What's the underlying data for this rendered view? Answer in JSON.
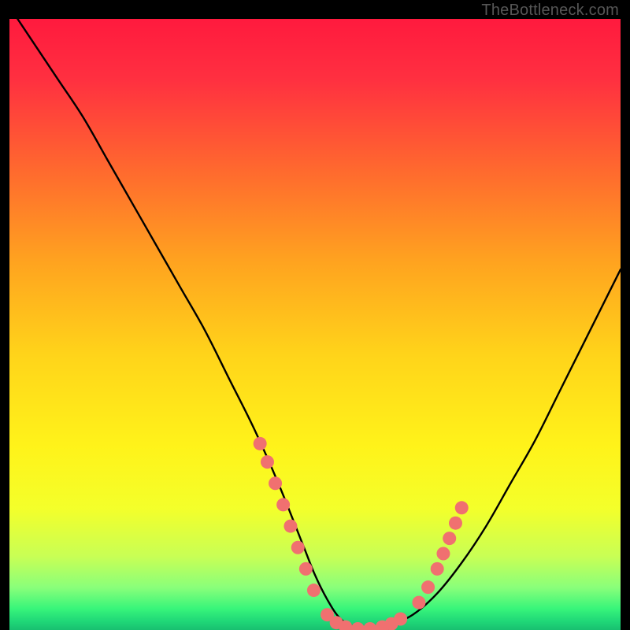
{
  "watermark": "TheBottleneck.com",
  "chart_data": {
    "type": "line",
    "title": "",
    "xlabel": "",
    "ylabel": "",
    "xlim": [
      0,
      100
    ],
    "ylim": [
      0,
      100
    ],
    "series": [
      {
        "name": "curve",
        "x": [
          0,
          4,
          8,
          12,
          16,
          20,
          24,
          28,
          32,
          36,
          40,
          44,
          48,
          50,
          52,
          54,
          56,
          58,
          60,
          62,
          66,
          70,
          74,
          78,
          82,
          86,
          90,
          94,
          98,
          100
        ],
        "y": [
          102,
          96,
          90,
          84,
          77,
          70,
          63,
          56,
          49,
          41,
          33,
          24,
          14,
          9,
          5,
          2,
          0.7,
          0.2,
          0.2,
          0.7,
          2.5,
          6,
          11,
          17,
          24,
          31,
          39,
          47,
          55,
          59
        ]
      }
    ],
    "markers": {
      "name": "dots",
      "color": "#f07070",
      "points": [
        {
          "x": 41.0,
          "y": 30.5
        },
        {
          "x": 42.2,
          "y": 27.5
        },
        {
          "x": 43.5,
          "y": 24.0
        },
        {
          "x": 44.8,
          "y": 20.5
        },
        {
          "x": 46.0,
          "y": 17.0
        },
        {
          "x": 47.2,
          "y": 13.5
        },
        {
          "x": 48.5,
          "y": 10.0
        },
        {
          "x": 49.8,
          "y": 6.5
        },
        {
          "x": 52.0,
          "y": 2.5
        },
        {
          "x": 53.5,
          "y": 1.2
        },
        {
          "x": 55.0,
          "y": 0.5
        },
        {
          "x": 57.0,
          "y": 0.2
        },
        {
          "x": 59.0,
          "y": 0.2
        },
        {
          "x": 61.0,
          "y": 0.5
        },
        {
          "x": 62.5,
          "y": 1.0
        },
        {
          "x": 64.0,
          "y": 1.8
        },
        {
          "x": 67.0,
          "y": 4.5
        },
        {
          "x": 68.5,
          "y": 7.0
        },
        {
          "x": 70.0,
          "y": 10.0
        },
        {
          "x": 71.0,
          "y": 12.5
        },
        {
          "x": 72.0,
          "y": 15.0
        },
        {
          "x": 73.0,
          "y": 17.5
        },
        {
          "x": 74.0,
          "y": 20.0
        }
      ]
    },
    "gradient_stops": [
      {
        "offset": 0.0,
        "color": "#ff1a3e"
      },
      {
        "offset": 0.1,
        "color": "#ff3040"
      },
      {
        "offset": 0.25,
        "color": "#ff6a2e"
      },
      {
        "offset": 0.4,
        "color": "#ffa41f"
      },
      {
        "offset": 0.55,
        "color": "#ffd41a"
      },
      {
        "offset": 0.7,
        "color": "#fff31a"
      },
      {
        "offset": 0.8,
        "color": "#f4ff2a"
      },
      {
        "offset": 0.88,
        "color": "#c8ff55"
      },
      {
        "offset": 0.93,
        "color": "#8aff7a"
      },
      {
        "offset": 0.965,
        "color": "#38f57a"
      },
      {
        "offset": 0.985,
        "color": "#20d878"
      },
      {
        "offset": 1.0,
        "color": "#18c070"
      }
    ]
  }
}
